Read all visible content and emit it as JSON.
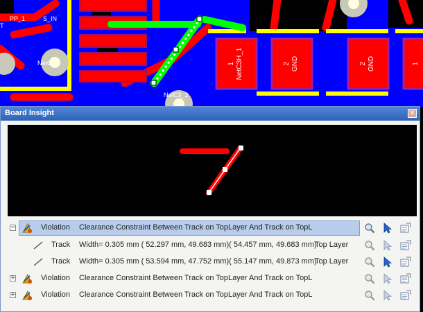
{
  "pcb": {
    "labels": [
      "PP_1",
      "S_IN",
      "NetC_2",
      "NetC3_2",
      "T"
    ],
    "pads": [
      {
        "num": "1",
        "net": "NetC3H_1"
      },
      {
        "num": "2",
        "net": "GND"
      },
      {
        "num": "2",
        "net": "GND"
      },
      {
        "num": "1",
        "net": ""
      }
    ],
    "colors": {
      "board": "#0000ff",
      "track": "#ff0000",
      "selected": "#00ff00",
      "silk": "#ffff00"
    }
  },
  "panel": {
    "title": "Board Insight",
    "close_icon": "close-icon",
    "preview": {
      "tracks": 2
    }
  },
  "results": [
    {
      "kind": "violation",
      "expander": "−",
      "type": "Violation",
      "description": "Clearance Constraint Between Track on TopLayer And Track on TopL",
      "selected": true
    },
    {
      "kind": "track",
      "type": "Track",
      "description": "Width=  0.305 mm ( 52.297 mm, 49.683 mm)( 54.457 mm, 49.683 mm)",
      "layer": "Top Layer"
    },
    {
      "kind": "track",
      "type": "Track",
      "description": "Width=  0.305 mm ( 53.594 mm, 47.752 mm)( 55.147 mm, 49.873 mm)",
      "layer": "Top Layer"
    },
    {
      "kind": "violation",
      "expander": "+",
      "type": "Violation",
      "description": "Clearance Constraint Between Track on TopLayer And Track on TopL"
    },
    {
      "kind": "violation",
      "expander": "+",
      "type": "Violation",
      "description": "Clearance Constraint Between Track on TopLayer And Track on TopL"
    }
  ],
  "action_icons": [
    "zoom-icon",
    "select-cursor-icon",
    "properties-icon"
  ]
}
